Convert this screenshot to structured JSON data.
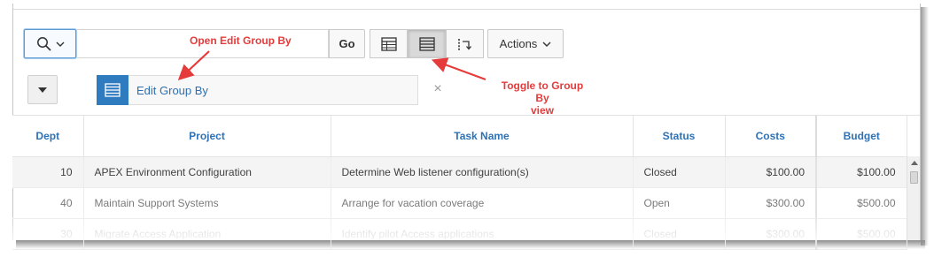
{
  "toolbar": {
    "search_icon": "search-icon",
    "search_placeholder": "",
    "go_label": "Go",
    "actions_label": "Actions",
    "views": [
      "grid-view-icon",
      "group-by-view-icon",
      "pivot-view-icon"
    ],
    "active_view": "group-by-view-icon"
  },
  "group_by": {
    "label": "Edit Group By",
    "remove": "×"
  },
  "annotations": {
    "edit_group_by": "Open Edit Group By",
    "toggle_line1": "Toggle to Group By",
    "toggle_line2": "view"
  },
  "table": {
    "headers": [
      "Dept",
      "Project",
      "Task Name",
      "Status",
      "Costs",
      "Budget"
    ],
    "rows": [
      [
        "10",
        "APEX Environment Configuration",
        "Determine Web listener configuration(s)",
        "Closed",
        "$100.00",
        "$100.00"
      ],
      [
        "40",
        "Maintain Support Systems",
        "Arrange for vacation coverage",
        "Open",
        "$300.00",
        "$500.00"
      ],
      [
        "30",
        "Migrate Access Application",
        "Identify pilot Access applications",
        "Closed",
        "$300.00",
        "$500.00"
      ]
    ]
  },
  "colors": {
    "accent": "#2f7bc0",
    "link": "#2e72b5",
    "annotation": "#e53b3b"
  }
}
